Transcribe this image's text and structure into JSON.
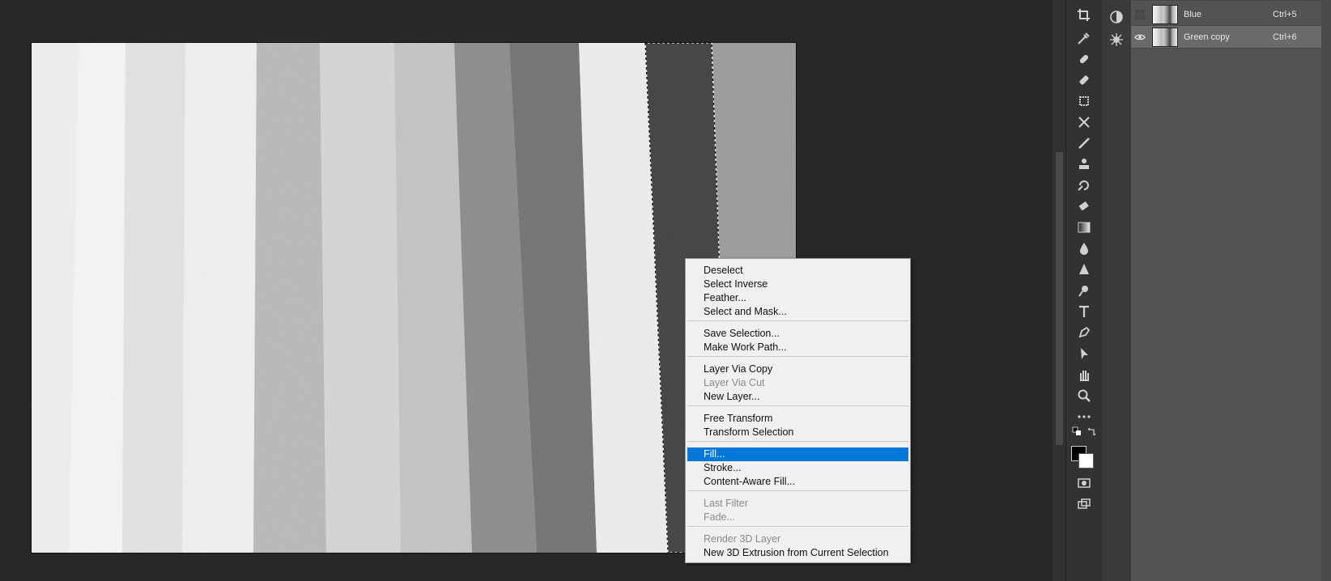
{
  "layers": [
    {
      "name": "Blue",
      "shortcut": "Ctrl+5",
      "visible": false,
      "selected": false
    },
    {
      "name": "Green copy",
      "shortcut": "Ctrl+6",
      "visible": true,
      "selected": true
    }
  ],
  "context_menu": {
    "groups": [
      [
        {
          "label": "Deselect",
          "enabled": true
        },
        {
          "label": "Select Inverse",
          "enabled": true
        },
        {
          "label": "Feather...",
          "enabled": true
        },
        {
          "label": "Select and Mask...",
          "enabled": true
        }
      ],
      [
        {
          "label": "Save Selection...",
          "enabled": true
        },
        {
          "label": "Make Work Path...",
          "enabled": true
        }
      ],
      [
        {
          "label": "Layer Via Copy",
          "enabled": true
        },
        {
          "label": "Layer Via Cut",
          "enabled": false
        },
        {
          "label": "New Layer...",
          "enabled": true
        }
      ],
      [
        {
          "label": "Free Transform",
          "enabled": true
        },
        {
          "label": "Transform Selection",
          "enabled": true
        }
      ],
      [
        {
          "label": "Fill...",
          "enabled": true,
          "highlighted": true
        },
        {
          "label": "Stroke...",
          "enabled": true
        },
        {
          "label": "Content-Aware Fill...",
          "enabled": true
        }
      ],
      [
        {
          "label": "Last Filter",
          "enabled": false
        },
        {
          "label": "Fade...",
          "enabled": false
        }
      ],
      [
        {
          "label": "Render 3D Layer",
          "enabled": false
        },
        {
          "label": "New 3D Extrusion from Current Selection",
          "enabled": true
        }
      ]
    ]
  },
  "tools": [
    "crop-icon",
    "eyedropper-icon",
    "spot-healing-icon",
    "healing-brush-icon",
    "patch-icon",
    "content-aware-move-icon",
    "brush-icon",
    "clone-stamp-icon",
    "history-brush-icon",
    "eraser-icon",
    "gradient-icon",
    "blur-icon",
    "sharpen-icon",
    "dodge-icon",
    "type-icon",
    "pen-icon",
    "path-selection-icon",
    "hand-icon",
    "zoom-icon",
    "more-tools-icon"
  ],
  "colors": {
    "foreground": "#000000",
    "background": "#ffffff",
    "menu_highlight": "#0078d7"
  }
}
